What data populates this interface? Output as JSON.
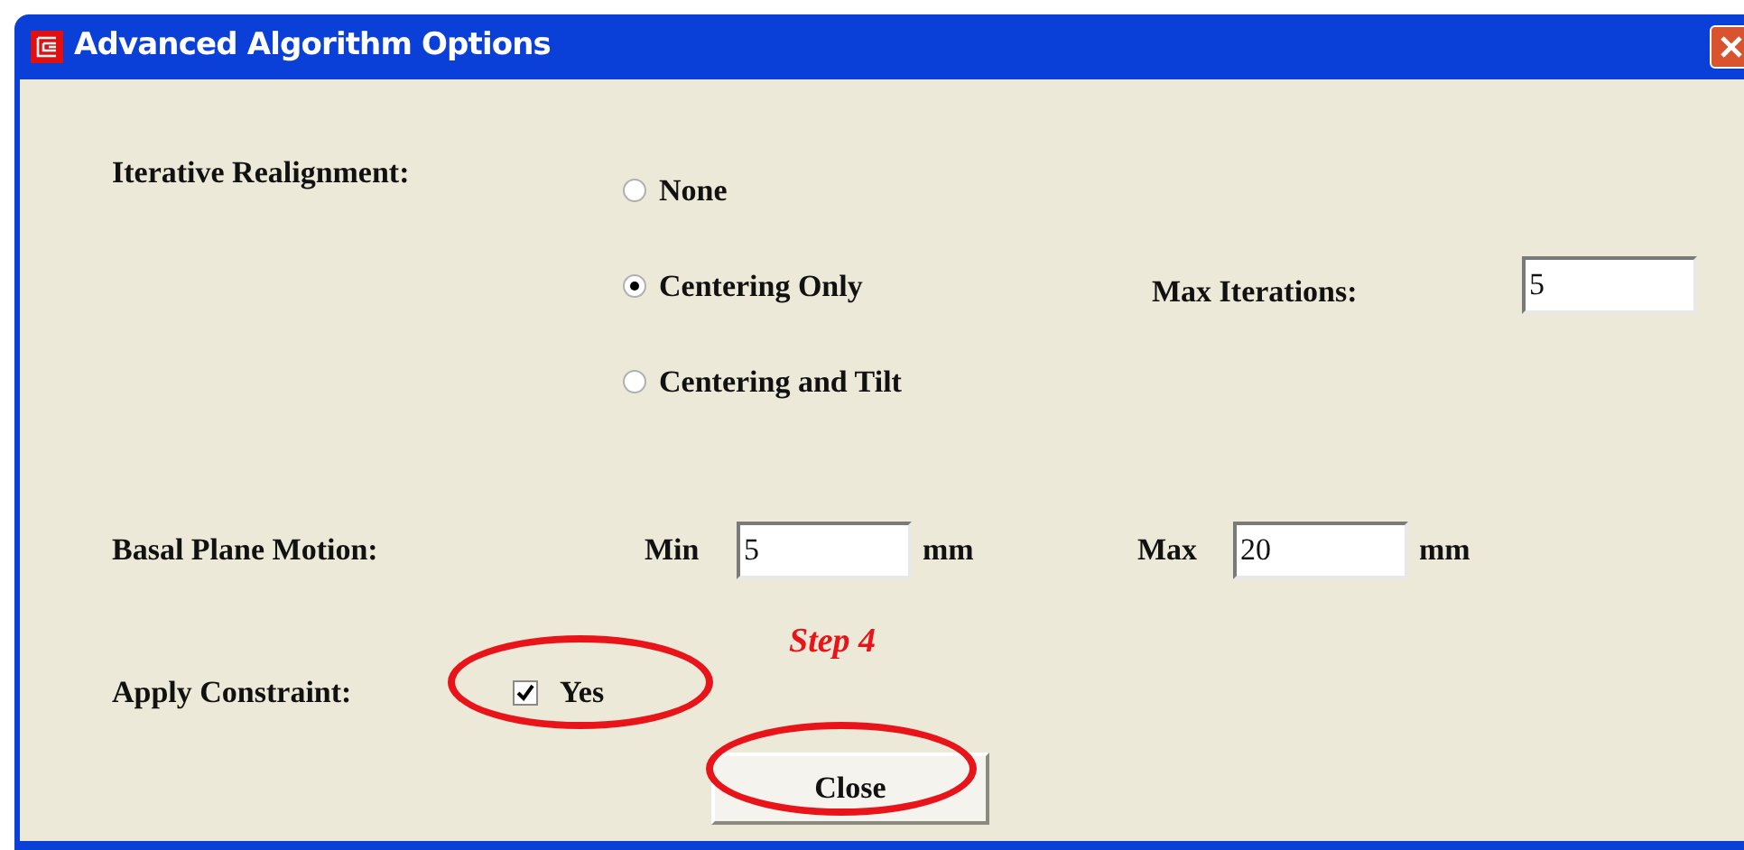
{
  "window": {
    "title": "Advanced Algorithm Options"
  },
  "iterative_realignment": {
    "label": "Iterative Realignment:",
    "options": [
      {
        "label": "None",
        "selected": false
      },
      {
        "label": "Centering Only",
        "selected": true
      },
      {
        "label": "Centering and Tilt",
        "selected": false
      }
    ]
  },
  "max_iterations": {
    "label": "Max Iterations:",
    "value": "5"
  },
  "basal_plane_motion": {
    "label": "Basal Plane Motion:",
    "min_label": "Min",
    "min_value": "5",
    "min_unit": "mm",
    "max_label": "Max",
    "max_value": "20",
    "max_unit": "mm"
  },
  "annotation": {
    "text": "Step 4"
  },
  "apply_constraint": {
    "label": "Apply Constraint:",
    "checkbox_label": "Yes",
    "checked": true
  },
  "buttons": [
    {
      "label": "Close"
    }
  ]
}
